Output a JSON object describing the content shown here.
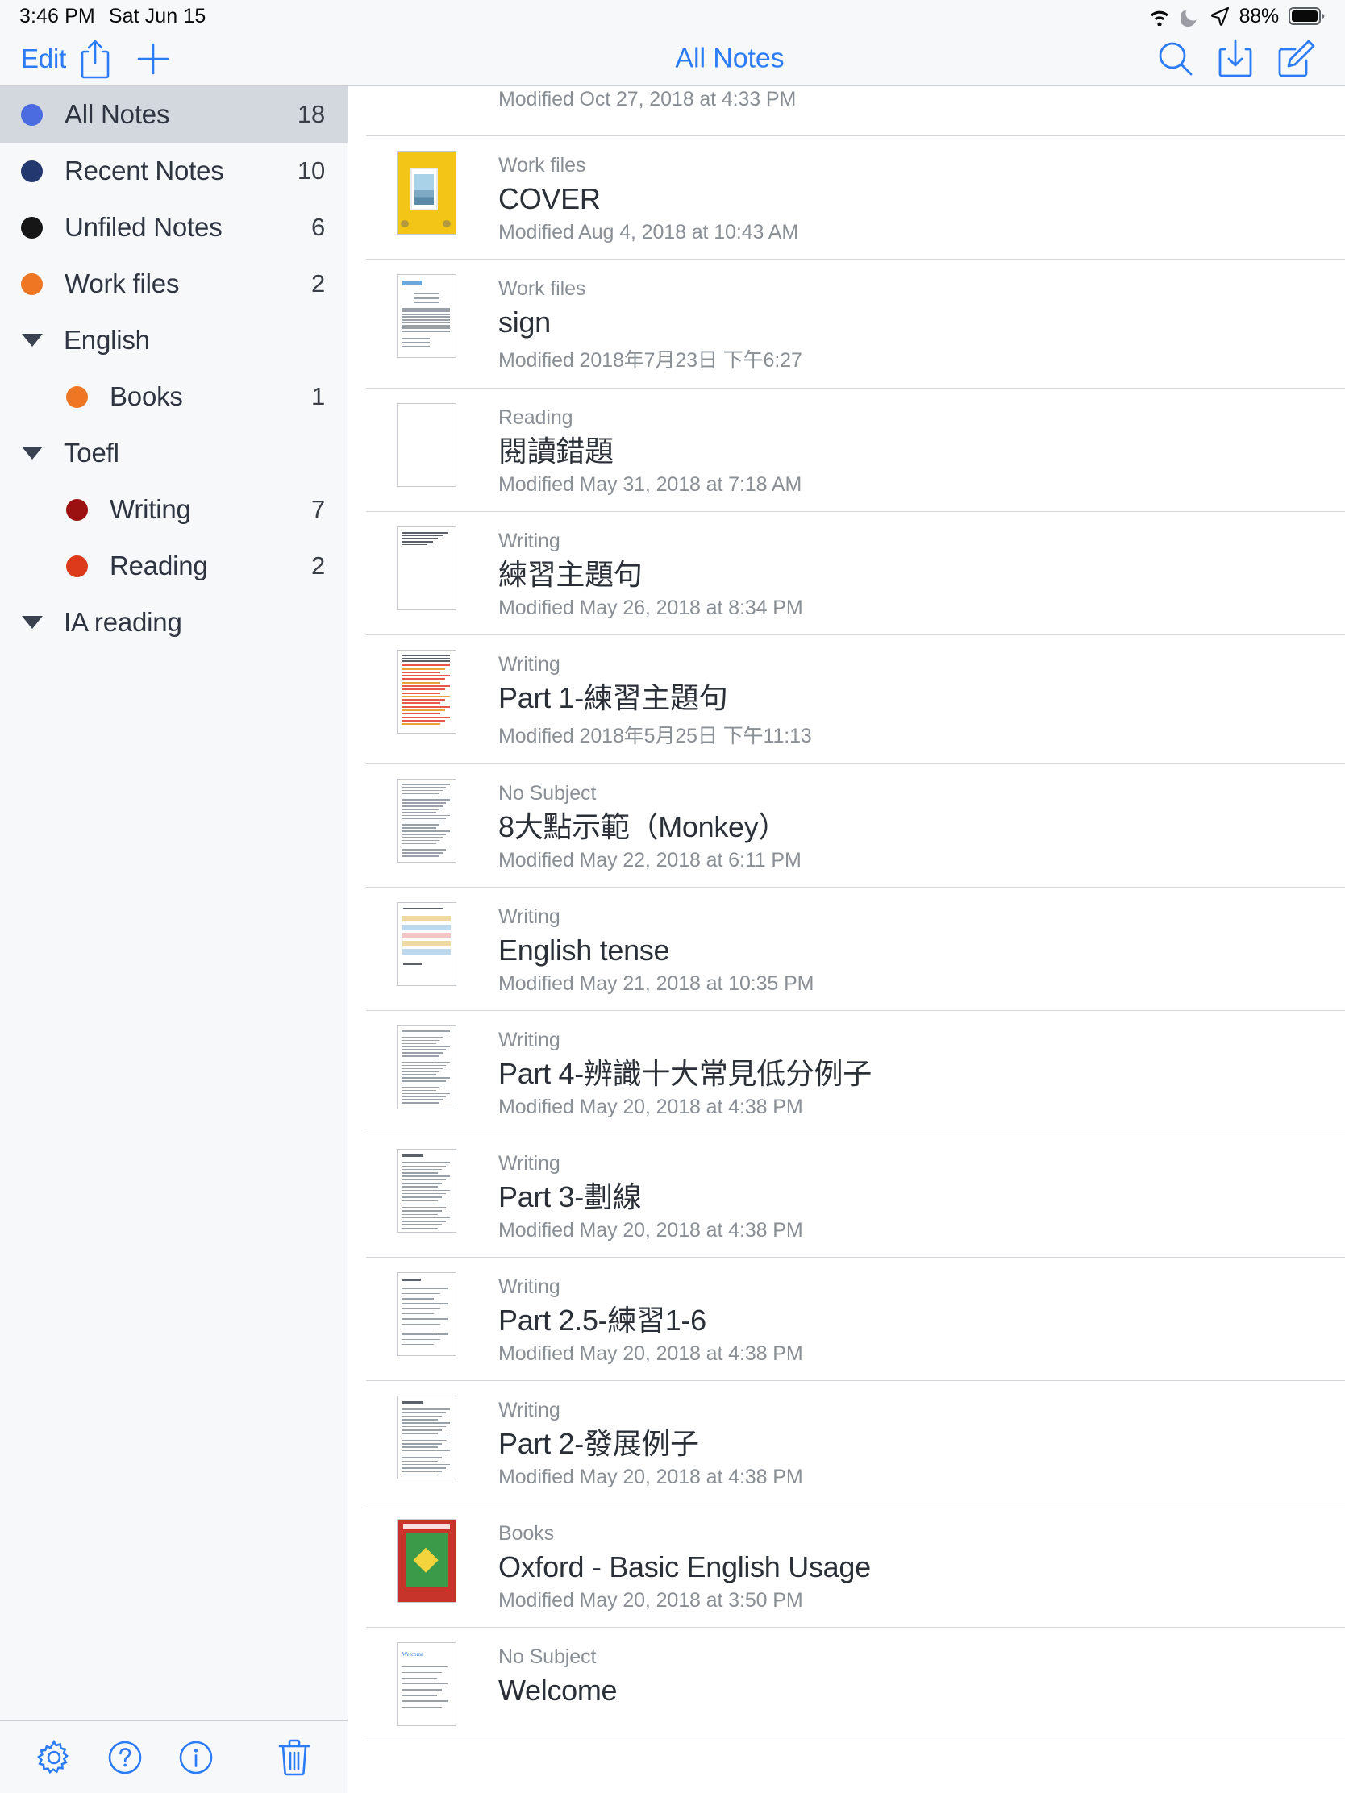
{
  "status_bar": {
    "time": "3:46 PM",
    "date": "Sat Jun 15",
    "battery_percent": "88%",
    "icons": [
      "wifi-icon",
      "moon-icon",
      "location-arrow-icon",
      "battery-icon"
    ]
  },
  "toolbar": {
    "edit_label": "Edit",
    "title": "All Notes",
    "left_icons": [
      "share-icon",
      "add-icon"
    ],
    "right_icons": [
      "search-icon",
      "import-icon",
      "compose-icon"
    ]
  },
  "sidebar": {
    "items": [
      {
        "label": "All Notes",
        "count": "18",
        "color": "#4a6ce0",
        "type": "dot",
        "selected": true,
        "indent": 0
      },
      {
        "label": "Recent Notes",
        "count": "10",
        "color": "#23386e",
        "type": "dot",
        "selected": false,
        "indent": 0
      },
      {
        "label": "Unfiled Notes",
        "count": "6",
        "color": "#161616",
        "type": "dot",
        "selected": false,
        "indent": 0
      },
      {
        "label": "Work files",
        "count": "2",
        "color": "#ef7622",
        "type": "dot",
        "selected": false,
        "indent": 0
      },
      {
        "label": "English",
        "count": "",
        "color": "",
        "type": "group",
        "selected": false,
        "indent": 0
      },
      {
        "label": "Books",
        "count": "1",
        "color": "#ef7622",
        "type": "dot",
        "selected": false,
        "indent": 1
      },
      {
        "label": "Toefl",
        "count": "",
        "color": "",
        "type": "group",
        "selected": false,
        "indent": 0
      },
      {
        "label": "Writing",
        "count": "7",
        "color": "#9b1010",
        "type": "dot",
        "selected": false,
        "indent": 1
      },
      {
        "label": "Reading",
        "count": "2",
        "color": "#dc3a1a",
        "type": "dot",
        "selected": false,
        "indent": 1
      },
      {
        "label": "IA reading",
        "count": "",
        "color": "",
        "type": "group",
        "selected": false,
        "indent": 0
      }
    ],
    "bottom_icons": [
      "settings-gear-icon",
      "help-question-icon",
      "info-icon",
      "trash-icon"
    ]
  },
  "notes": [
    {
      "folder": "",
      "title": "",
      "modified": "Modified Oct 27, 2018 at 4:33 PM",
      "thumb": "lines",
      "clipped": true
    },
    {
      "folder": "Work files",
      "title": "COVER",
      "modified": "Modified Aug 4, 2018 at 10:43 AM",
      "thumb": "cover-photo"
    },
    {
      "folder": "Work files",
      "title": "sign",
      "modified": "Modified 2018年7月23日 下午6:27",
      "thumb": "doc-blue-header"
    },
    {
      "folder": "Reading",
      "title": "閱讀錯題",
      "modified": "Modified May 31, 2018 at 7:18 AM",
      "thumb": "blank"
    },
    {
      "folder": "Writing",
      "title": "練習主題句",
      "modified": "Modified May 26, 2018 at 8:34 PM",
      "thumb": "few-lines"
    },
    {
      "folder": "Writing",
      "title": "Part 1-練習主題句",
      "modified": "Modified 2018年5月25日 下午11:13",
      "thumb": "red-marked"
    },
    {
      "folder": "No Subject",
      "title": "8大點示範（Monkey）",
      "modified": "Modified May 22, 2018 at 6:11 PM",
      "thumb": "dense-text"
    },
    {
      "folder": "Writing",
      "title": "English tense",
      "modified": "Modified May 21, 2018 at 10:35 PM",
      "thumb": "color-table"
    },
    {
      "folder": "Writing",
      "title": "Part 4-辨識十大常見低分例子",
      "modified": "Modified May 20, 2018 at 4:38 PM",
      "thumb": "dense-text"
    },
    {
      "folder": "Writing",
      "title": "Part 3-劃線",
      "modified": "Modified May 20, 2018 at 4:38 PM",
      "thumb": "titled-text"
    },
    {
      "folder": "Writing",
      "title": "Part 2.5-練習1-6",
      "modified": "Modified May 20, 2018 at 4:38 PM",
      "thumb": "sparse-text"
    },
    {
      "folder": "Writing",
      "title": "Part 2-發展例子",
      "modified": "Modified May 20, 2018 at 4:38 PM",
      "thumb": "titled-text"
    },
    {
      "folder": "Books",
      "title": "Oxford - Basic English Usage",
      "modified": "Modified May 20, 2018 at 3:50 PM",
      "thumb": "book-cover"
    },
    {
      "folder": "No Subject",
      "title": "Welcome",
      "modified": "",
      "thumb": "welcome",
      "clipped_bottom": true
    }
  ],
  "colors": {
    "accent_blue": "#2b7cf6",
    "sidebar_bg": "#f7f8fa",
    "selected_row": "#d3d7de",
    "separator": "#c9ccd1",
    "secondary_text": "#8a8f96",
    "primary_text": "#2b3038"
  }
}
